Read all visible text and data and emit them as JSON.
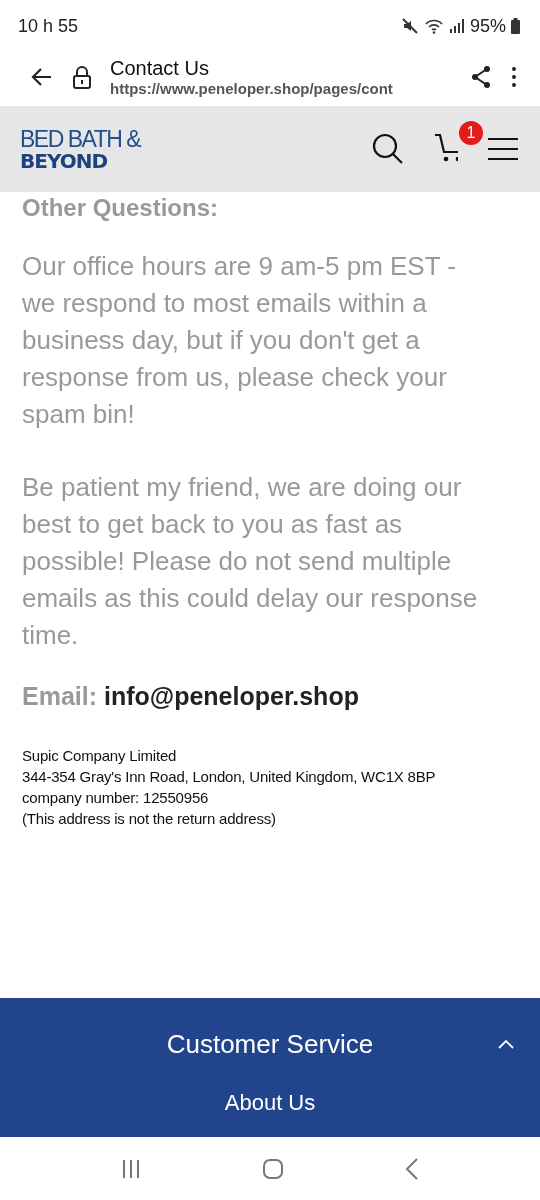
{
  "status_bar": {
    "time": "10 h 55",
    "battery": "95%"
  },
  "browser": {
    "title": "Contact Us",
    "url": "https://www.peneloper.shop/pages/cont"
  },
  "site_header": {
    "logo_top": "BED BATH &",
    "logo_bottom": "BEYOND",
    "cart_count": "1"
  },
  "content": {
    "heading": "Other Questions:",
    "paragraphs": [
      "Our office hours are 9 am-5 pm EST - we respond to most emails within a business day, but if you don't get a response from us, please check your spam bin!",
      "Be patient my friend, we are doing our best to get back to you as fast as possible! Please do not send multiple emails as this could delay our response time."
    ],
    "email_label": "Email:",
    "email": "info@peneloper.shop",
    "address_lines": [
      "Supic Company Limited",
      "344-354 Gray's Inn Road, London, United Kingdom, WC1X 8BP",
      "company number:  12550956",
      "(This address is not the return address)"
    ]
  },
  "footer": {
    "section": {
      "title": "Customer Service",
      "expanded": true
    },
    "links": [
      "About Us"
    ]
  }
}
